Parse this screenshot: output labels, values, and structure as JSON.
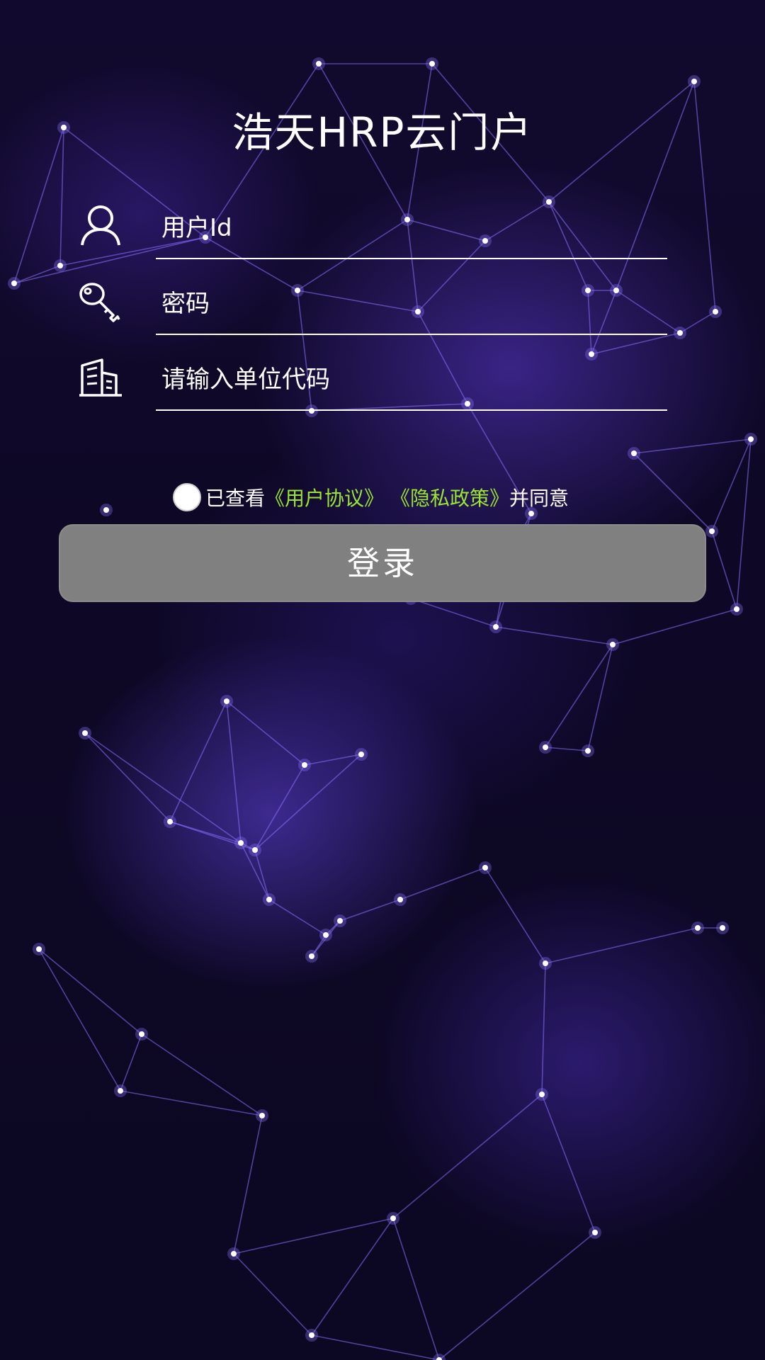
{
  "app": {
    "title": "浩天HRP云门户"
  },
  "form": {
    "user_id": {
      "placeholder": "用户Id",
      "value": "",
      "icon": "user-icon"
    },
    "password": {
      "placeholder": "密码",
      "value": "",
      "icon": "key-icon"
    },
    "org_code": {
      "placeholder": "请输入单位代码",
      "value": "",
      "icon": "building-icon"
    }
  },
  "agreement": {
    "checked": false,
    "prefix": "已查看",
    "user_agreement": "《用户协议》",
    "separator": " ",
    "privacy_policy": "《隐私政策》",
    "suffix": "并同意"
  },
  "login": {
    "label": "登录"
  },
  "colors": {
    "link": "#9be532",
    "button": "#808080",
    "background": "#0e0826",
    "network": "#8a72ff"
  }
}
